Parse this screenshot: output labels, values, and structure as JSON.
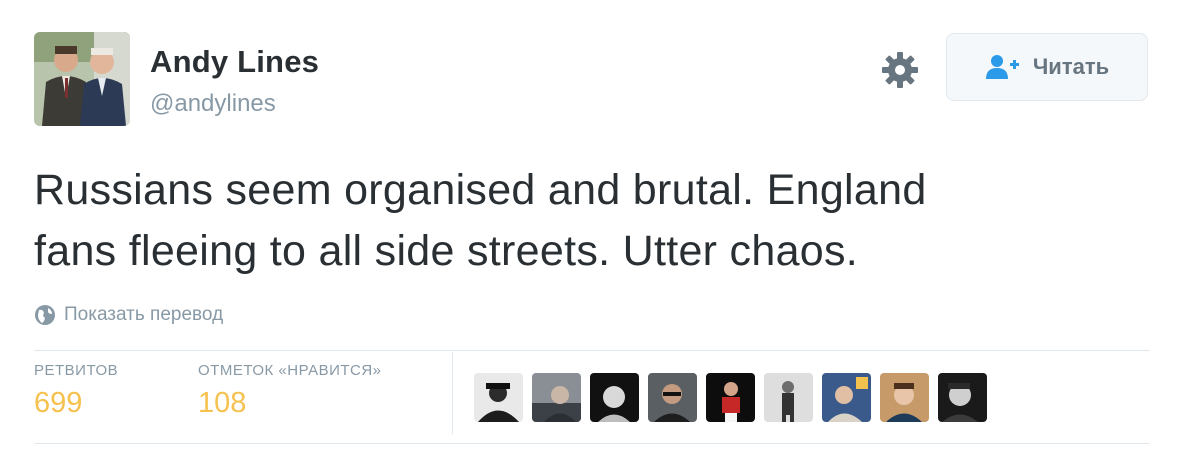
{
  "author": {
    "name": "Andy Lines",
    "handle": "@andylines"
  },
  "header": {
    "settings_icon": "gear-icon",
    "follow_label": "Читать",
    "follow_icon": "add-user-icon"
  },
  "tweet": {
    "line1": "Russians seem organised and brutal.  England",
    "line2": "fans fleeing to all side streets. Utter chaos."
  },
  "translate": {
    "icon": "globe-icon",
    "label": "Показать перевод"
  },
  "stats": {
    "retweets_label": "РЕТВИТОВ",
    "retweets_value": "699",
    "likes_label": "ОТМЕТОК «НРАВИТСЯ»",
    "likes_value": "108"
  },
  "likers_count": 9,
  "colors": {
    "text": "#292f33",
    "muted": "#8899a6",
    "follow_icon": "#2b9ae9",
    "stat_value": "#f7c14f",
    "border": "#e1e8ed"
  }
}
